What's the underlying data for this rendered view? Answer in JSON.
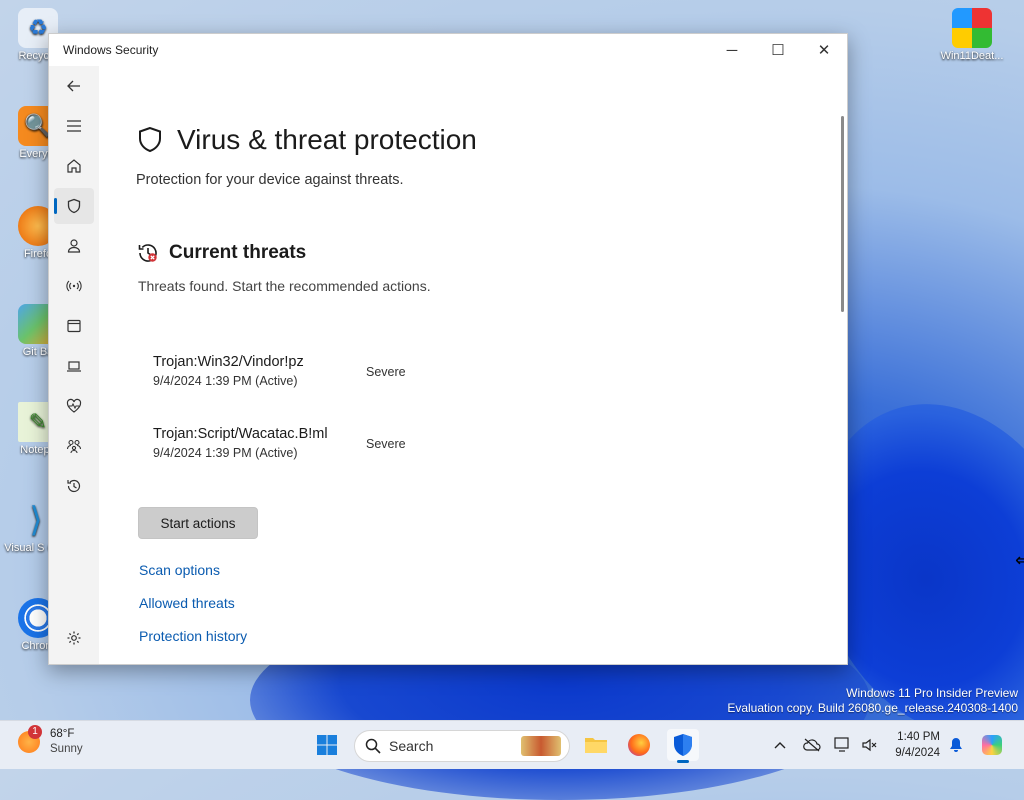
{
  "window": {
    "title": "Windows Security",
    "controls": {
      "minimize": "─",
      "maximize": "☐",
      "close": "✕"
    }
  },
  "nav": [
    {
      "name": "back-icon",
      "glyph": "←"
    },
    {
      "name": "menu-icon",
      "glyph": "≡"
    },
    {
      "name": "home-icon",
      "glyph": "home"
    },
    {
      "name": "shield-icon",
      "glyph": "shield",
      "active": true
    },
    {
      "name": "account-icon",
      "glyph": "person"
    },
    {
      "name": "network-icon",
      "glyph": "wifi"
    },
    {
      "name": "app-browser-icon",
      "glyph": "window"
    },
    {
      "name": "device-security-icon",
      "glyph": "laptop"
    },
    {
      "name": "health-icon",
      "glyph": "heart"
    },
    {
      "name": "family-icon",
      "glyph": "family"
    },
    {
      "name": "history-icon",
      "glyph": "history"
    },
    {
      "name": "settings-icon",
      "glyph": "gear"
    }
  ],
  "page": {
    "title": "Virus & threat protection",
    "subtitle": "Protection for your device against threats.",
    "section_title": "Current threats",
    "section_desc": "Threats found. Start the recommended actions."
  },
  "threats": [
    {
      "name": "Trojan:Win32/Vindor!pz",
      "date": "9/4/2024 1:39 PM (Active)",
      "severity": "Severe"
    },
    {
      "name": "Trojan:Script/Wacatac.B!ml",
      "date": "9/4/2024 1:39 PM (Active)",
      "severity": "Severe"
    }
  ],
  "actions": {
    "start_label": "Start actions",
    "links": [
      "Scan options",
      "Allowed threats",
      "Protection history"
    ]
  },
  "desktop": {
    "icons": [
      "Recycle",
      "Everyth",
      "Firefo",
      "Git Ba",
      "Notepa",
      "Visual S Cod",
      "Chrom",
      "Win11Deat..."
    ],
    "watermark_line1": "Windows 11 Pro Insider Preview",
    "watermark_line2": "Evaluation copy. Build 26080.ge_release.240308-1400"
  },
  "taskbar": {
    "weather_temp": "68°F",
    "weather_cond": "Sunny",
    "weather_badge": "1",
    "search_placeholder": "Search",
    "time": "1:40 PM",
    "date": "9/4/2024"
  },
  "colors": {
    "accent": "#0067c0",
    "link": "#0a5bb0",
    "threat_red": "#d13438"
  }
}
